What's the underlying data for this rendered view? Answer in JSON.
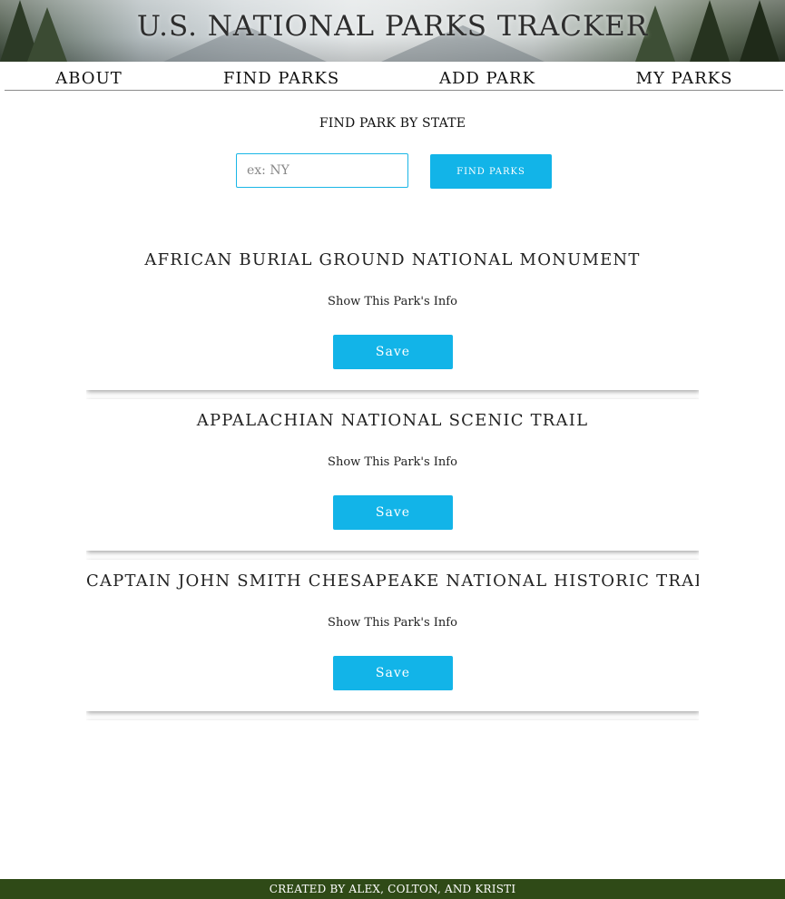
{
  "header": {
    "title": "U.S. NATIONAL PARKS TRACKER"
  },
  "nav": {
    "items": [
      {
        "label": "ABOUT"
      },
      {
        "label": "FIND PARKS"
      },
      {
        "label": "ADD PARK"
      },
      {
        "label": "MY PARKS"
      }
    ]
  },
  "search": {
    "label": "FIND PARK BY STATE",
    "value": "",
    "placeholder": "ex: NY",
    "button_label": "FIND PARKS"
  },
  "parks": [
    {
      "name": "AFRICAN BURIAL GROUND NATIONAL MONUMENT",
      "info_label": "Show This Park's Info",
      "save_label": "Save"
    },
    {
      "name": "APPALACHIAN NATIONAL SCENIC TRAIL",
      "info_label": "Show This Park's Info",
      "save_label": "Save"
    },
    {
      "name": "CAPTAIN JOHN SMITH CHESAPEAKE NATIONAL HISTORIC TRAIL",
      "info_label": "Show This Park's Info",
      "save_label": "Save"
    }
  ],
  "footer": {
    "text": "CREATED BY ALEX, COLTON, AND KRISTI"
  },
  "colors": {
    "accent": "#12b4e8",
    "footer_bg": "#2f4a17"
  }
}
